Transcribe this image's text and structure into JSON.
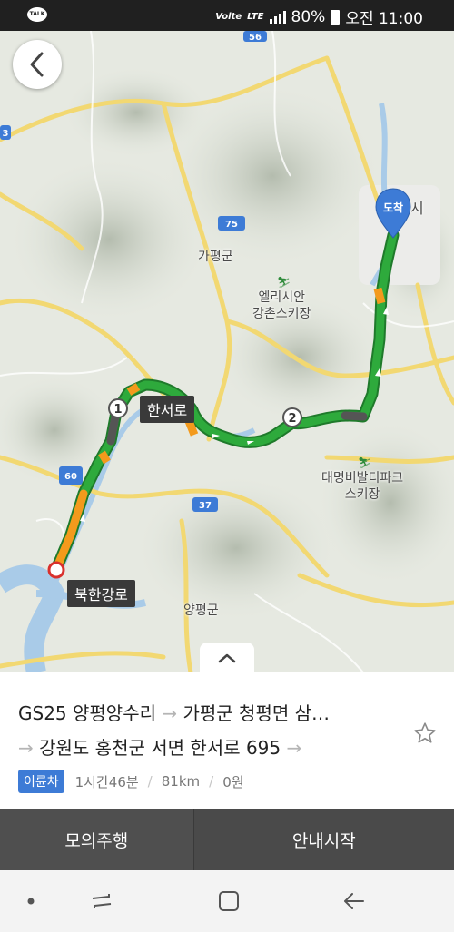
{
  "status_bar": {
    "app_icon": "kakaotalk-icon",
    "app_icon_label": "TALK",
    "volte": "Volte",
    "network": "LTE",
    "battery": "80%",
    "time": "오전 11:00"
  },
  "map": {
    "road_labels": {
      "r56": "56",
      "r75": "75",
      "r60": "60",
      "r37": "37",
      "r3": "3"
    },
    "place_labels": {
      "gapyeong": "가평군",
      "elysian": "엘리시안\n강촌스키장",
      "daemyung": "대명비발디파크\n스키장",
      "yangpyeong": "양평군",
      "city": "시"
    },
    "route_labels": {
      "hanseoro": "한서로",
      "bukhangangro": "북한강로"
    },
    "markers": {
      "waypoint1": "1",
      "waypoint2": "2",
      "destination": "도착"
    }
  },
  "route": {
    "line1": {
      "origin": "GS25 양평양수리",
      "arrow": "→",
      "via": "가평군 청평면 삼…"
    },
    "line2": {
      "arrow": "→",
      "destination": "강원도 홍천군 서면 한서로 695",
      "arrow_end": "→"
    }
  },
  "meta": {
    "vehicle": "이륜차",
    "duration": "1시간46분",
    "distance": "81km",
    "toll": "0원",
    "separator": "/"
  },
  "buttons": {
    "simulate": "모의주행",
    "start": "안내시작"
  },
  "colors": {
    "route_green": "#2eaa3c",
    "route_orange": "#f39a1c",
    "route_gray": "#555555",
    "destination_blue": "#3d7bd6",
    "badge_blue": "#3d7bd6"
  }
}
